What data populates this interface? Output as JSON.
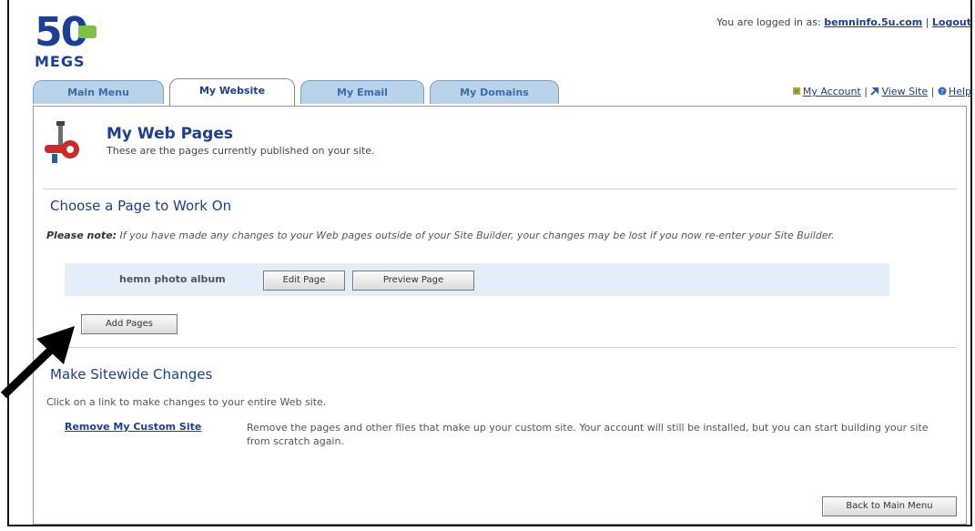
{
  "logo": {
    "number": "50",
    "subtext": "MEGS"
  },
  "login": {
    "prefix": "You are logged in as:",
    "user": "bemninfo.5u.com",
    "separator": "|",
    "logout": "Logout"
  },
  "tabs": [
    {
      "label": "Main Menu"
    },
    {
      "label": "My Website"
    },
    {
      "label": "My Email"
    },
    {
      "label": "My Domains"
    }
  ],
  "toplinks": {
    "account": "My Account",
    "view_site": "View Site",
    "help": "Help",
    "sep": "|"
  },
  "page": {
    "title": "My Web Pages",
    "subtitle": "These are the pages currently published on your site."
  },
  "choose": {
    "title": "Choose a Page to Work On",
    "note_label": "Please note:",
    "note_text": " If you have made any changes to your Web pages outside of your Site Builder, your changes may be lost if you now re-enter your Site Builder.",
    "album_name": "hemn photo album",
    "edit_button": "Edit Page",
    "preview_button": "Preview Page",
    "add_button": "Add Pages"
  },
  "sitewide": {
    "title": "Make Sitewide Changes",
    "text": "Click on a link to make changes to your entire Web site.",
    "remove_link": "Remove My Custom Site",
    "remove_desc": "Remove the pages and other files that make up your custom site. Your account will still be installed, but you can start building your site from scratch again."
  },
  "back_button": "Back to Main Menu",
  "colors": {
    "brand_blue": "#1a3f9a",
    "tab_bg": "#b8d3ea",
    "row_bg": "#e3eef9",
    "logo_green": "#7dc242"
  },
  "icons": [
    "tools-icon",
    "account-icon",
    "view-site-icon",
    "help-icon",
    "arrow-icon"
  ]
}
